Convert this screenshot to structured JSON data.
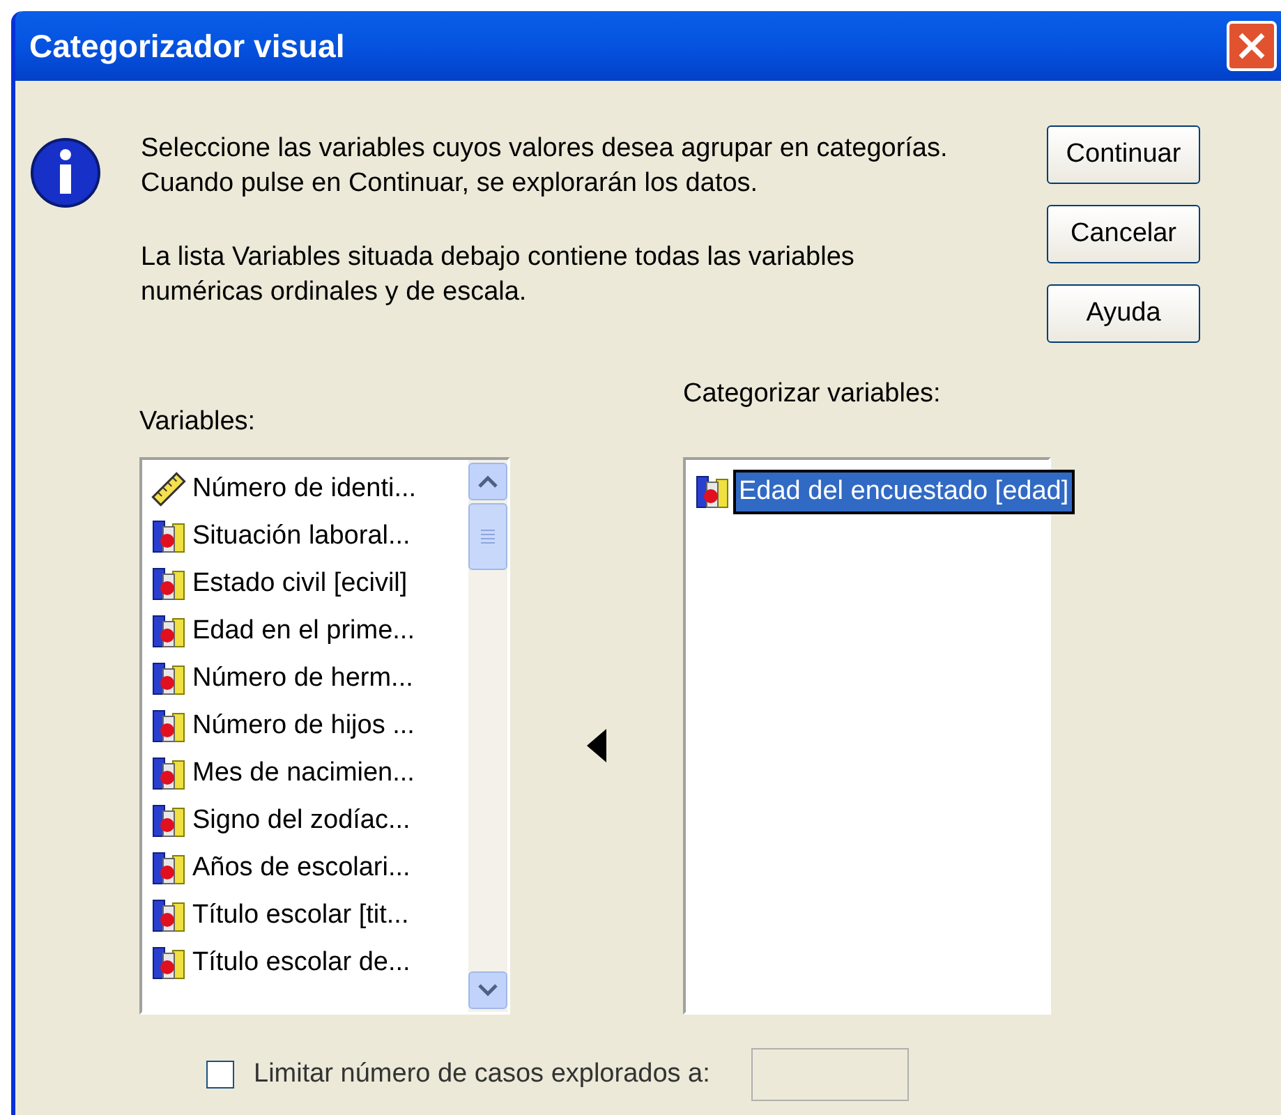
{
  "window": {
    "title": "Categorizador visual"
  },
  "instructions": [
    "Seleccione las variables cuyos valores desea agrupar en categorías. Cuando pulse en Continuar, se explorarán los datos.",
    "La lista Variables situada debajo contiene todas las variables numéricas ordinales y de escala."
  ],
  "buttons": [
    "Continuar",
    "Cancelar",
    "Ayuda"
  ],
  "variables": {
    "label": "Variables:",
    "items": [
      {
        "name": "Número de identi...",
        "kind": "scale",
        "selected": false
      },
      {
        "name": "Situación laboral...",
        "kind": "ordinal",
        "selected": false
      },
      {
        "name": "Estado civil [ecivil]",
        "kind": "ordinal",
        "selected": false
      },
      {
        "name": "Edad en el prime...",
        "kind": "ordinal",
        "selected": false
      },
      {
        "name": "Número de herm...",
        "kind": "ordinal",
        "selected": false
      },
      {
        "name": "Número de hijos ...",
        "kind": "ordinal",
        "selected": false
      },
      {
        "name": "Mes de nacimien...",
        "kind": "ordinal",
        "selected": false
      },
      {
        "name": "Signo del zodíac...",
        "kind": "ordinal",
        "selected": false
      },
      {
        "name": "Años de escolari...",
        "kind": "ordinal",
        "selected": false
      },
      {
        "name": "Título escolar [tit...",
        "kind": "ordinal",
        "selected": false
      },
      {
        "name": "Título escolar de...",
        "kind": "ordinal",
        "selected": false
      }
    ]
  },
  "categorize": {
    "label": "Categorizar variables:",
    "items": [
      {
        "name": "Edad del encuestado [edad]",
        "kind": "ordinal",
        "selected": true
      }
    ]
  },
  "limit": {
    "label": "Limitar número de casos explorados a:",
    "checked": false
  }
}
